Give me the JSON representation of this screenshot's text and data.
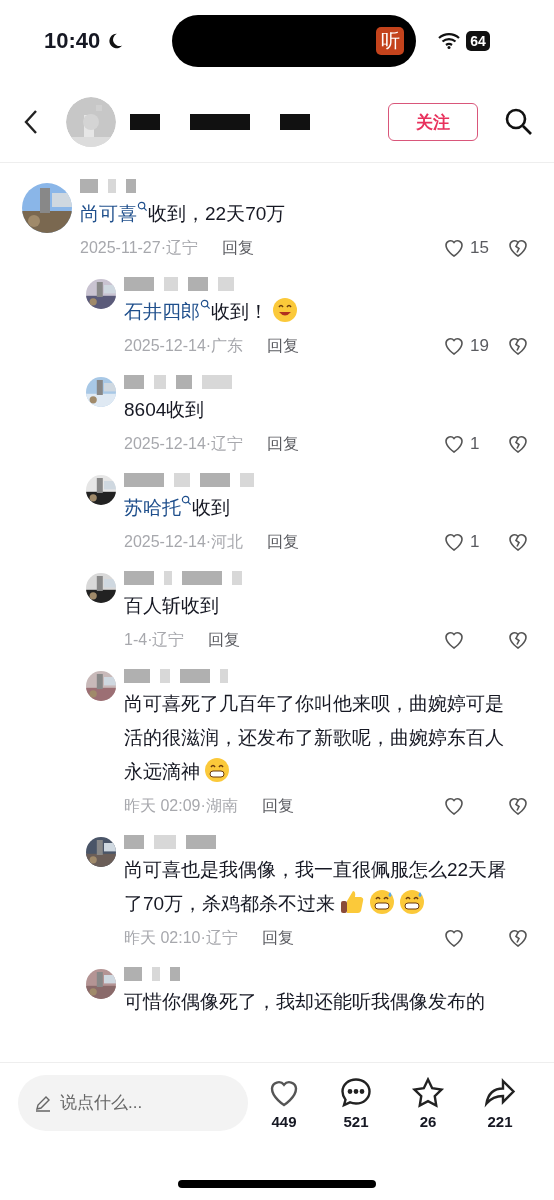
{
  "status_bar": {
    "time": "10:40",
    "island_app_label": "听",
    "battery": "64"
  },
  "header": {
    "follow_button": "关注"
  },
  "comments": [
    {
      "mention": "尚可喜",
      "text": "收到，22天70万",
      "meta": "2025-11-27·辽宁",
      "reply_label": "回复",
      "likes": "15",
      "children": [
        {
          "mention": "石井四郎",
          "text": "收到！",
          "emojis": [
            {
              "kind": "smile"
            }
          ],
          "meta": "2025-12-14·广东",
          "reply_label": "回复",
          "likes": "19"
        },
        {
          "text": "8604收到",
          "meta": "2025-12-14·辽宁",
          "reply_label": "回复",
          "likes": "1"
        },
        {
          "mention": "苏哈托",
          "text": "收到",
          "meta": "2025-12-14·河北",
          "reply_label": "回复",
          "likes": "1"
        },
        {
          "text": "百人斩收到",
          "meta": "1-4·辽宁",
          "reply_label": "回复"
        },
        {
          "text": "尚可喜死了几百年了你叫他来呗，曲婉婷可是活的很滋润，还发布了新歌呢，曲婉婷东百人永远滴神",
          "emojis": [
            {
              "kind": "grin"
            }
          ],
          "meta": "昨天 02:09·湖南",
          "reply_label": "回复"
        },
        {
          "text": "尚可喜也是我偶像，我一直很佩服怎么22天屠了70万，杀鸡都杀不过来",
          "emojis": [
            {
              "kind": "thumbs"
            },
            {
              "kind": "sweat"
            },
            {
              "kind": "sweat"
            }
          ],
          "meta": "昨天 02:10·辽宁",
          "reply_label": "回复"
        },
        {
          "text": "可惜你偶像死了，我却还能听我偶像发布的"
        }
      ]
    }
  ],
  "bottom_bar": {
    "input": {
      "placeholder": "说点什么..."
    },
    "actions": [
      {
        "kind": "like",
        "count": "449"
      },
      {
        "kind": "comment",
        "count": "521"
      },
      {
        "kind": "favorite",
        "count": "26"
      },
      {
        "kind": "share",
        "count": "221"
      }
    ]
  }
}
